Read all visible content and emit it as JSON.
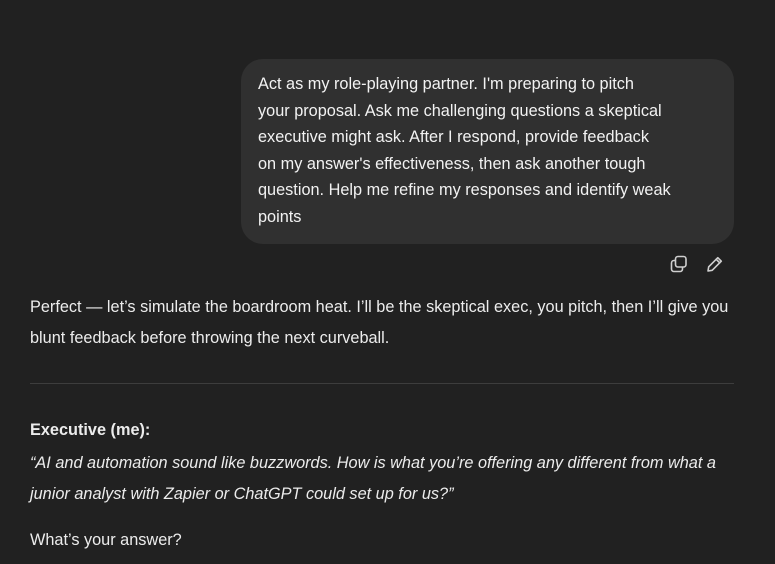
{
  "user_message": {
    "text": "Act as my role-playing partner. I'm preparing to pitch\nyour proposal. Ask me challenging questions a skeptical\nexecutive might ask. After I respond, provide feedback\non my answer's effectiveness, then ask another tough\nquestion. Help me refine my responses and identify weak\npoints"
  },
  "message_actions": {
    "copy_icon": "copy-icon",
    "edit_icon": "pencil-icon"
  },
  "assistant_message": {
    "intro": "Perfect — let’s simulate the boardroom heat. I’ll be the skeptical exec, you pitch, then I’ll give you blunt feedback before throwing the next curveball.",
    "speaker_label": "Executive (me):",
    "question": "“AI and automation sound like buzzwords. How is what you’re offering any different from what a junior analyst with Zapier or ChatGPT could set up for us?”",
    "prompt": "What’s your answer?"
  },
  "colors": {
    "background": "#212121",
    "bubble": "#303030",
    "text": "#ececec"
  }
}
